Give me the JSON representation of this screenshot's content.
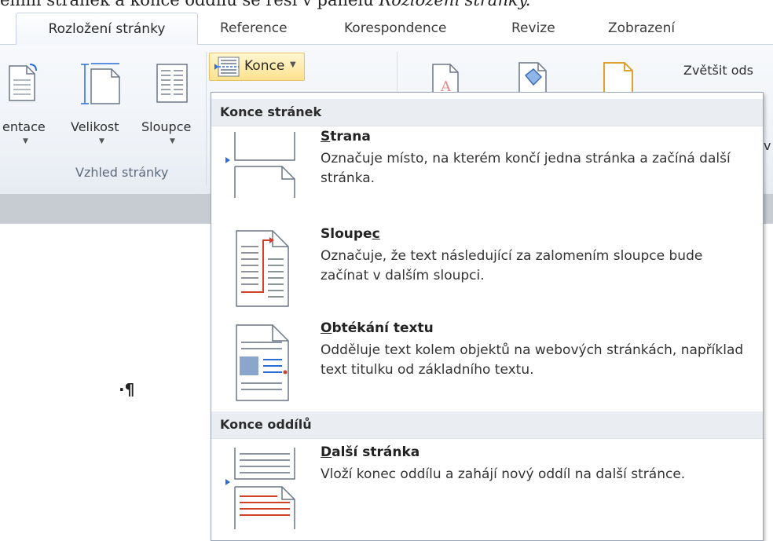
{
  "caption": {
    "text_normal": "ením stránek a konce oddílu se řeší v panelu ",
    "text_italic": "Rozložení stránky."
  },
  "tabs": [
    "Rozložení stránky",
    "Reference",
    "Korespondence",
    "Revize",
    "Zobrazení"
  ],
  "ribbon": {
    "buttons": {
      "orientation": "entace",
      "size": "Velikost",
      "columns": "Sloupce"
    },
    "group_label": "Vzhled stránky",
    "konce_label": "Konce",
    "right_label": "Zvětšit ods",
    "right_fragment_1": ":",
    "right_fragment_2": "v"
  },
  "document": {
    "paragraph_mark": "·¶"
  },
  "menu": {
    "section_page_breaks": "Konce stránek",
    "section_section_breaks": "Konce oddílů",
    "items": [
      {
        "title_accel": "S",
        "title_rest": "trana",
        "description": "Označuje místo, na kterém končí jedna stránka a začíná další stránka."
      },
      {
        "title_pre": "Sloupe",
        "title_accel": "c",
        "description": "Označuje, že text následující za zalomením sloupce bude začínat v dalším sloupci."
      },
      {
        "title_accel": "O",
        "title_rest": "btékání textu",
        "description": "Odděluje text kolem objektů na webových stránkách, například text titulku od základního textu."
      },
      {
        "title_accel": "D",
        "title_rest": "alší stránka",
        "description": "Vloží konec oddílu a zahájí nový oddíl na další stránce."
      }
    ]
  },
  "colors": {
    "active_button": "#ffe28e",
    "ribbon_bg": "#eef2f7",
    "menu_header_bg": "#eaedf1",
    "break_marker": "#2b6cd6",
    "column_break_accent": "#d0402a"
  }
}
